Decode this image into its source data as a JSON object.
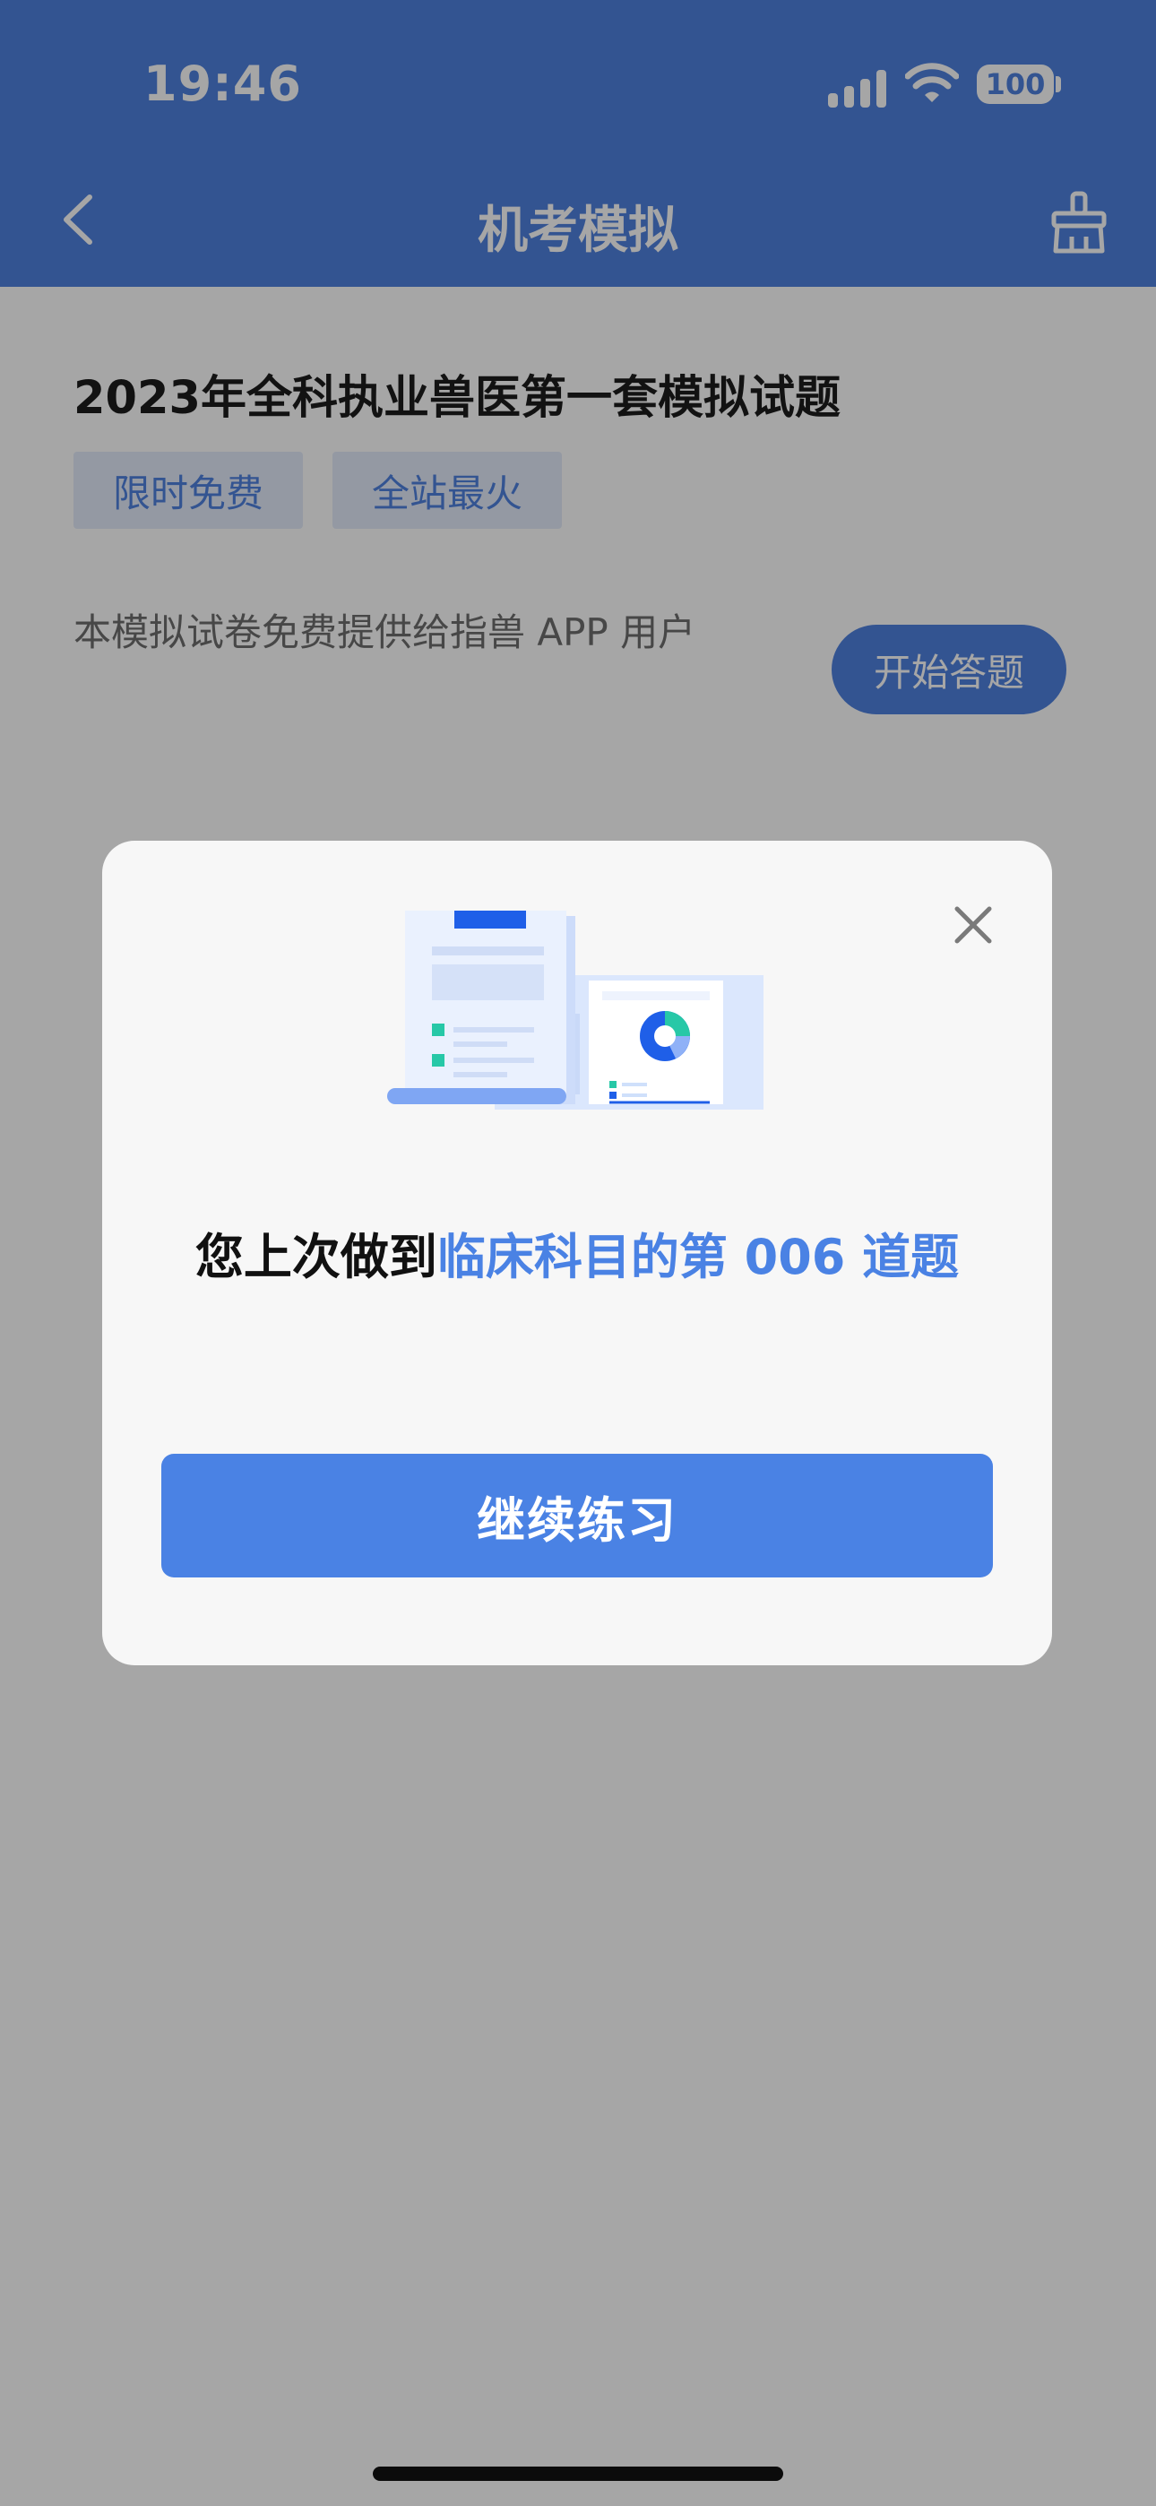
{
  "status_bar": {
    "time": "19:46",
    "battery": "100",
    "icons": [
      "signal-icon",
      "wifi-icon",
      "battery-icon"
    ]
  },
  "nav": {
    "title": "机考模拟",
    "back_icon": "chevron-left-icon",
    "right_icon": "broom-clean-icon"
  },
  "exam_card": {
    "title": "2023年全科执业兽医第一套模拟试题",
    "tags": [
      "限时免费",
      "全站最火"
    ],
    "description": "本模拟试卷免费提供给指兽 APP 用户",
    "start_label": "开始答题"
  },
  "modal": {
    "message_prefix": "您上次做到",
    "message_highlight": "临床科目的第 006 道题",
    "continue_label": "继续练习",
    "close_icon": "close-icon"
  },
  "colors": {
    "primary": "#4f81df",
    "modal_accent": "#4a82e4",
    "overlay": "rgba(0,0,0,0.35)"
  }
}
